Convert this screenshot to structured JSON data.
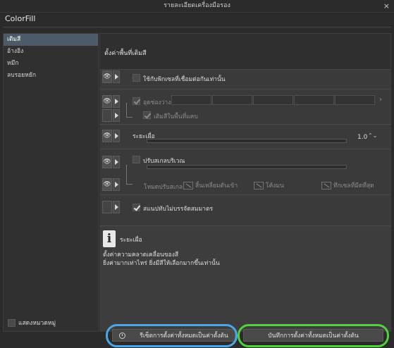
{
  "window": {
    "title": "รายละเอียดเครื่องมือรอง",
    "close_glyph": "×"
  },
  "tool_name": "ColorFill",
  "sidebar": {
    "items": [
      {
        "label": "เติมสี",
        "active": true
      },
      {
        "label": "อ้างอิง",
        "active": false
      },
      {
        "label": "หมึก",
        "active": false
      },
      {
        "label": "ลบรอยหยัก",
        "active": false
      }
    ],
    "show_all_label": "แสดงหมวดหมู่"
  },
  "panel": {
    "header": "ตั้งค่าพื้นที่เติมสี",
    "settings": {
      "contiguous_label": "ใช้กับพิกเซลที่เชื่อมต่อกันเท่านั้น",
      "close_gap_label": "อุดช่องว่าง",
      "fill_gap_pixels_label": "เติมสีในพื้นที่แคบ",
      "tolerance_label": "ระยะเผื่อ",
      "tolerance_value": "1.0",
      "area_scaling_label": "ปรับสเกลบริเวณ",
      "scaling_mode_label": "โหมดปรับสเกล",
      "mode_options": [
        "สิ้นเหลี่ยมตันเข้า",
        "โค้งมน",
        "ทึกเซลที่มีดที่สุด"
      ],
      "fill_behind_label": "สแนปทับไม่บรรจัดสมมาตร"
    },
    "info": {
      "title": "ระยะเผื่อ",
      "line1": "ตั้งค่าความคลาดเคลื่อนของสี",
      "line2": "ยิ่งค่ามากเท่าไหร่ ยิ่งมีสีให้เลือกมากขึ้นเท่านั้น"
    }
  },
  "footer": {
    "reset_label": "รีเซ็ตการตั้งค่าทั้งหมดเป็นค่าตั้งต้น",
    "save_label": "บันทึกการตั้งค่าทั้งหมดเป็นค่าตั้งต้น",
    "reset_ring_color": "#4aa8e8",
    "save_ring_color": "#4fd33a"
  }
}
